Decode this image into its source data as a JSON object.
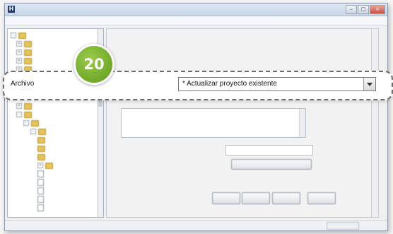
{
  "callout": {
    "badge_number": "20",
    "field_label": "Archivo",
    "selected_value": "* Actualizar proyecto existente"
  },
  "colors": {
    "badge_green": "#7bb534",
    "callout_border": "#6b6b6b"
  }
}
